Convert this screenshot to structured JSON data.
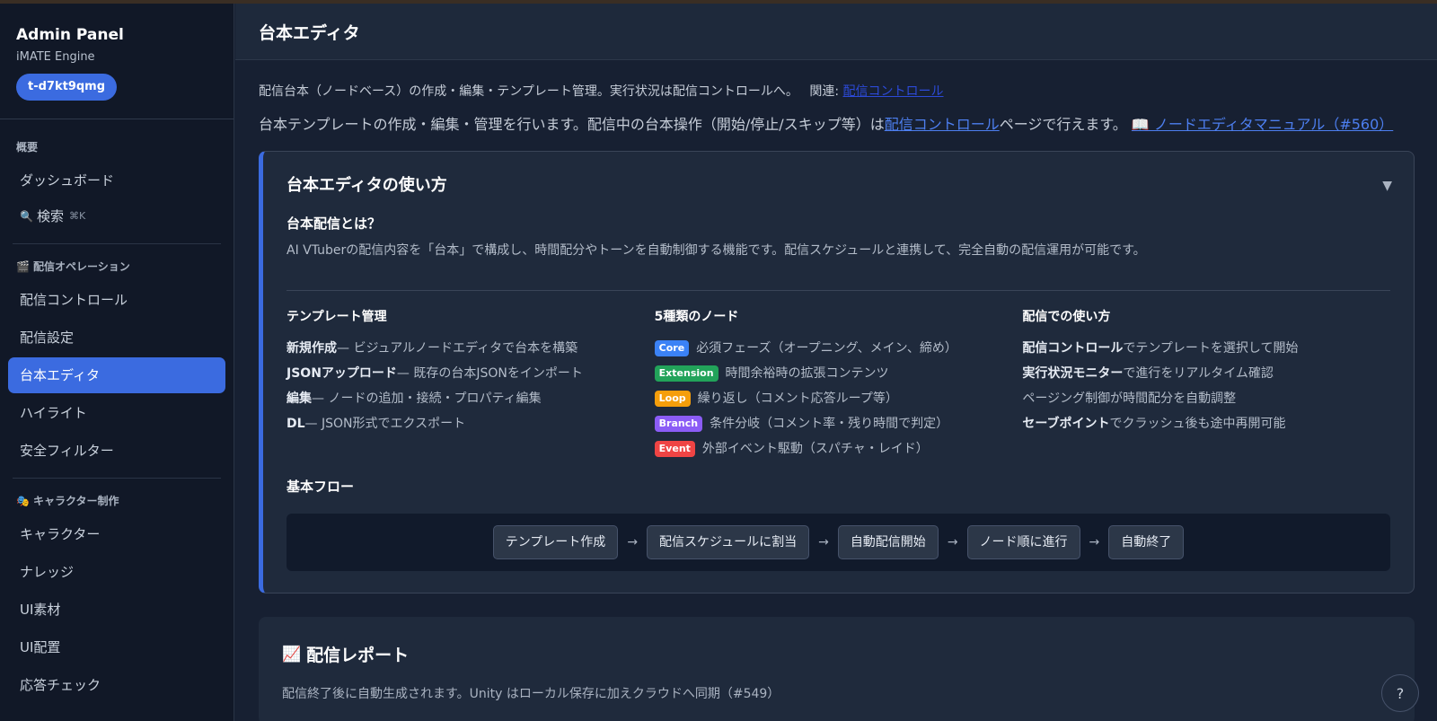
{
  "sidebar": {
    "title": "Admin Panel",
    "subtitle": "iMATE Engine",
    "tenant": "t-d7kt9qmg",
    "section_overview": "概要",
    "dashboard": "ダッシュボード",
    "search": "検索",
    "search_kbd": "⌘K",
    "section_ops": "配信オペレーション",
    "ops_items": [
      "配信コントロール",
      "配信設定",
      "台本エディタ",
      "ハイライト",
      "安全フィルター"
    ],
    "section_char": "キャラクター制作",
    "char_items": [
      "キャラクター",
      "ナレッジ",
      "UI素材",
      "UI配置",
      "応答チェック"
    ]
  },
  "header": {
    "title": "台本エディタ"
  },
  "intro": {
    "desc1": "配信台本（ノードベース）の作成・編集・テンプレート管理。実行状況は配信コントロールへ。",
    "related_label": "関連:",
    "related_link": "配信コントロール",
    "desc2_pre": "台本テンプレートの作成・編集・管理を行います。配信中の台本操作（開始/停止/スキップ等）は",
    "desc2_link": "配信コントロール",
    "desc2_post": "ページで行えます。",
    "manual_link": "📖 ノードエディタマニュアル（#560）"
  },
  "guide": {
    "title": "台本エディタの使い方",
    "what_title": "台本配信とは？",
    "what_desc": "AI VTuberの配信内容を「台本」で構成し、時間配分やトーンを自動制御する機能です。配信スケジュールと連携して、完全自動の配信運用が可能です。",
    "template": {
      "title": "テンプレート管理",
      "items": [
        {
          "strong": "新規作成",
          "text": " — ビジュアルノードエディタで台本を構築"
        },
        {
          "strong": "JSONアップロード",
          "text": " — 既存の台本JSONをインポート"
        },
        {
          "strong": "編集",
          "text": " — ノードの追加・接続・プロパティ編集"
        },
        {
          "strong": "DL",
          "text": " — JSON形式でエクスポート"
        }
      ]
    },
    "nodes": {
      "title": "5種類のノード",
      "items": [
        {
          "badge": "Core",
          "text": "必須フェーズ（オープニング、メイン、締め）"
        },
        {
          "badge": "Extension",
          "text": "時間余裕時の拡張コンテンツ"
        },
        {
          "badge": "Loop",
          "text": "繰り返し（コメント応答ループ等）"
        },
        {
          "badge": "Branch",
          "text": "条件分岐（コメント率・残り時間で判定）"
        },
        {
          "badge": "Event",
          "text": "外部イベント駆動（スパチャ・レイド）"
        }
      ]
    },
    "usage": {
      "title": "配信での使い方",
      "items": [
        {
          "strong": "配信コントロール",
          "text": "でテンプレートを選択して開始"
        },
        {
          "strong": "実行状況モニター",
          "text": "で進行をリアルタイム確認"
        },
        {
          "strong": "",
          "text": "ページング制御が時間配分を自動調整"
        },
        {
          "strong": "セーブポイント",
          "text": "でクラッシュ後も途中再開可能"
        }
      ]
    },
    "flow_title": "基本フロー",
    "flow_steps": [
      "テンプレート作成",
      "配信スケジュールに割当",
      "自動配信開始",
      "ノード順に進行",
      "自動終了"
    ]
  },
  "report": {
    "title": "配信レポート",
    "desc": "配信終了後に自動生成されます。Unity はローカル保存に加えクラウドへ同期（#549）"
  },
  "help_label": "?"
}
